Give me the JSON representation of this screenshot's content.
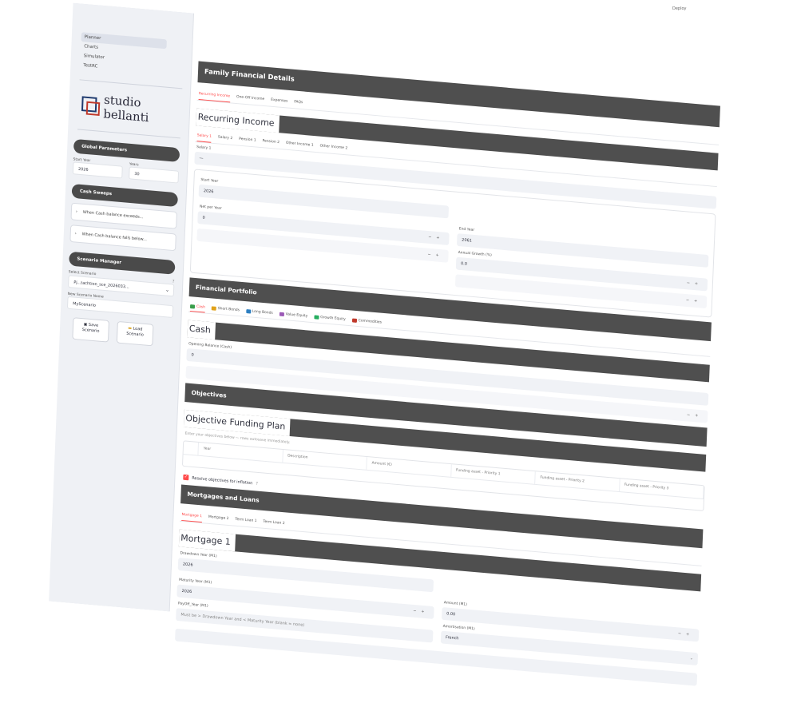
{
  "sidebar": {
    "nav": [
      "Planner",
      "Charts",
      "Simulator",
      "TestRC"
    ],
    "logo_text": "studio bellanti",
    "global": {
      "title": "Global Parameters",
      "start_year_label": "Start Year",
      "start_year": "2026",
      "years_label": "Years",
      "years": "30"
    },
    "sweeps": {
      "title": "Cash Sweeps",
      "items": [
        "When Cash balance exceeds...",
        "When Cash balance falls below..."
      ]
    },
    "scenario": {
      "title": "Scenario Manager",
      "select_label": "Select Scenario",
      "select_value": "Pj...tachtion_sce_2026033...",
      "new_label": "New Scenario Name",
      "new_value": "MyScenario",
      "save": [
        "Save",
        "Scenario"
      ],
      "load": [
        "Load",
        "Scenario"
      ]
    }
  },
  "deploy": "Deploy",
  "family": {
    "title": "Family Financial Details",
    "tabs": [
      "Recurring Income",
      "One-Off Income",
      "Expenses",
      "FAQs"
    ],
    "heading": "Recurring Income",
    "subtabs": [
      "Salary 1",
      "Salary 2",
      "Pension 1",
      "Pension 2",
      "Other Income 1",
      "Other Income 2"
    ],
    "salary_label": "Salary 1",
    "salary_value": "—",
    "start_year_label": "Start Year",
    "start_year": "2026",
    "end_year_label": "End Year",
    "end_year": "2061",
    "net_label": "Net per Year",
    "net": "0",
    "growth_label": "Annual Growth (%)",
    "growth": "0.0"
  },
  "portfolio": {
    "title": "Financial Portfolio",
    "tabs": [
      "Cash",
      "Short Bonds",
      "Long Bonds",
      "Value Equity",
      "Growth Equity",
      "Commodities"
    ],
    "heading": "Cash",
    "opening_label": "Opening Balance (Cash)",
    "opening": "0"
  },
  "objectives": {
    "title": "Objectives",
    "heading": "Objective Funding Plan",
    "caption": "Enter your objectives below — rows autosave immediately.",
    "columns": [
      "Year",
      "Description",
      "Amount (€)",
      "Funding asset - Priority 1",
      "Funding asset - Priority 2",
      "Funding asset - Priority 3"
    ],
    "check_label": "Resolve objectives for inflation"
  },
  "mortgages": {
    "title": "Mortgages and Loans",
    "tabs": [
      "Mortgage 1",
      "Mortgage 2",
      "Term Loan 1",
      "Term Loan 2"
    ],
    "heading": "Mortgage 1",
    "drawdown_label": "Drawdown Year (M1)",
    "drawdown": "2026",
    "maturity_label": "Maturity Year (M1)",
    "maturity": "2026",
    "amount_label": "Amount (M1)",
    "amount": "0.00",
    "payoff_label": "PayOff_Year (M1)",
    "payoff_placeholder": "Must be > Drawdown Year and < Maturity Year (blank = none)",
    "amort_label": "Amortisation (M1)",
    "amort": "French"
  },
  "colors": {
    "accent": "#ff4b4b",
    "header": "#4f4f4f",
    "sidebar": "#eff1f5"
  }
}
